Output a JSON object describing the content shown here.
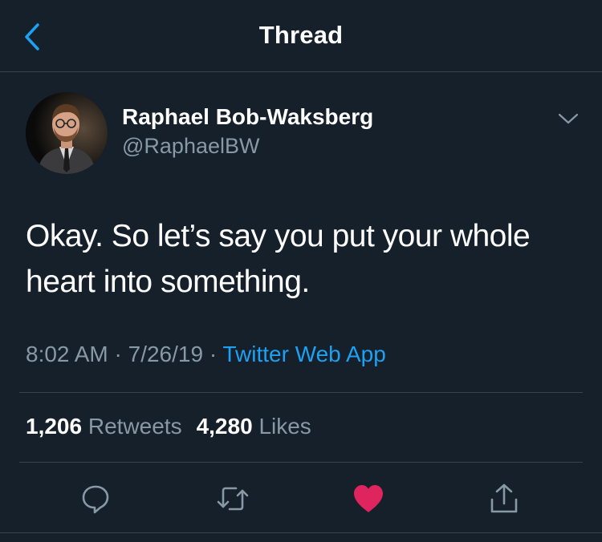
{
  "header": {
    "title": "Thread",
    "back_icon": "chevron-left-icon"
  },
  "tweet": {
    "author_name": "Raphael Bob-Waksberg",
    "author_handle": "@RaphaelBW",
    "text": "Okay. So let’s say you put your whole heart into something.",
    "time": "8:02 AM",
    "date": "7/26/19",
    "separator": "·",
    "source": "Twitter Web App"
  },
  "stats": {
    "retweets_count": "1,206",
    "retweets_label": "Retweets",
    "likes_count": "4,280",
    "likes_label": "Likes"
  },
  "actions": {
    "reply_icon": "reply-icon",
    "retweet_icon": "retweet-icon",
    "like_icon": "heart-icon",
    "share_icon": "share-icon"
  },
  "colors": {
    "background": "#15202b",
    "accent": "#1da1f2",
    "muted": "#8899a6",
    "like": "#e0245e",
    "divider": "#38444d"
  }
}
